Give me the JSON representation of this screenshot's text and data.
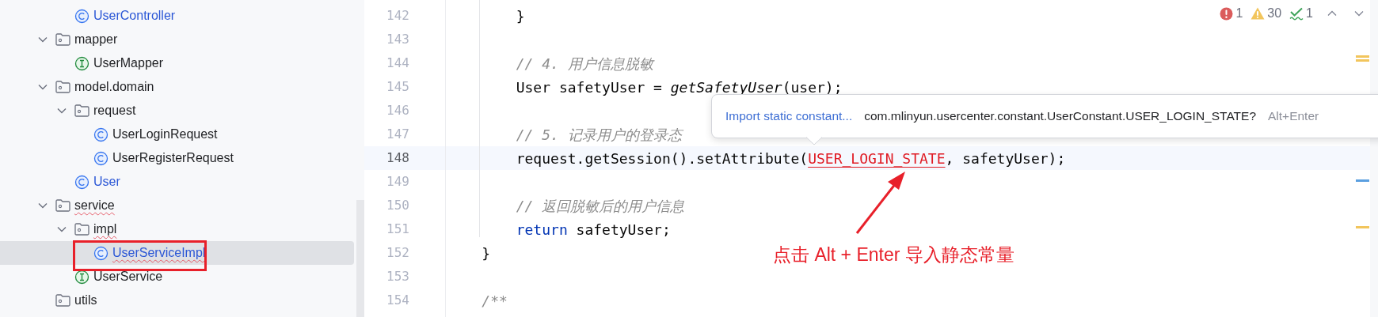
{
  "project_tree": {
    "continued_children": [
      {
        "name": "UserController",
        "kind": "class",
        "modified": true,
        "error": false,
        "selected": false
      }
    ],
    "items": [
      {
        "name": "mapper",
        "kind": "folder",
        "expanded": true,
        "error": false,
        "selected": false,
        "children": [
          {
            "name": "UserMapper",
            "kind": "interface",
            "modified": false,
            "error": false,
            "selected": false
          }
        ]
      },
      {
        "name": "model.domain",
        "kind": "folder",
        "expanded": true,
        "error": false,
        "selected": false,
        "children": [
          {
            "name": "request",
            "kind": "folder",
            "expanded": true,
            "error": false,
            "selected": false,
            "children": [
              {
                "name": "UserLoginRequest",
                "kind": "class",
                "modified": false,
                "error": false,
                "selected": false
              },
              {
                "name": "UserRegisterRequest",
                "kind": "class",
                "modified": false,
                "error": false,
                "selected": false
              }
            ]
          },
          {
            "name": "User",
            "kind": "class",
            "modified": true,
            "error": false,
            "selected": false
          }
        ]
      },
      {
        "name": "service",
        "kind": "folder",
        "expanded": true,
        "error": true,
        "selected": false,
        "children": [
          {
            "name": "impl",
            "kind": "folder",
            "expanded": true,
            "error": true,
            "selected": false,
            "children": [
              {
                "name": "UserServiceImpl",
                "kind": "class",
                "modified": true,
                "error": true,
                "selected": true,
                "framed": true
              }
            ]
          },
          {
            "name": "UserService",
            "kind": "interface",
            "modified": false,
            "error": false,
            "selected": false
          }
        ]
      },
      {
        "name": "utils",
        "kind": "folder",
        "expanded": false,
        "error": false,
        "selected": false
      }
    ]
  },
  "inspections": [
    {
      "kind": "error",
      "count": "1"
    },
    {
      "kind": "warning",
      "count": "30"
    },
    {
      "kind": "typo",
      "count": "1"
    }
  ],
  "stripe_marks": [
    {
      "kind": "warning"
    },
    {
      "kind": "info"
    },
    {
      "kind": "warning"
    }
  ],
  "code_lines": [
    {
      "number": "142",
      "current": false,
      "tokens": [
        {
          "kind": "plain",
          "text": "        }"
        }
      ]
    },
    {
      "number": "143",
      "current": false
    },
    {
      "number": "144",
      "current": false,
      "tokens": [
        {
          "kind": "comment",
          "text": "        // 4. 用户信息脱敏"
        }
      ]
    },
    {
      "number": "145",
      "current": false,
      "tokens": [
        {
          "kind": "plain",
          "text": "        User safetyUser = "
        },
        {
          "kind": "static_call",
          "text": "getSafetyUser"
        },
        {
          "kind": "plain",
          "text": "(user);"
        }
      ]
    },
    {
      "number": "146",
      "current": false
    },
    {
      "number": "147",
      "current": false,
      "tokens": [
        {
          "kind": "comment",
          "text": "        // 5. 记录用户的登录态"
        }
      ]
    },
    {
      "number": "148",
      "current": true,
      "tokens": [
        {
          "kind": "plain",
          "text": "        request.getSession().setAttribute("
        },
        {
          "kind": "unresolved",
          "text": "USER_LOGIN_STATE"
        },
        {
          "kind": "plain",
          "text": ", safetyUser);"
        }
      ]
    },
    {
      "number": "149",
      "current": false
    },
    {
      "number": "150",
      "current": false,
      "tokens": [
        {
          "kind": "comment",
          "text": "        // 返回脱敏后的用户信息"
        }
      ]
    },
    {
      "number": "151",
      "current": false,
      "tokens": [
        {
          "kind": "keyword",
          "text": "        return"
        },
        {
          "kind": "plain",
          "text": " safetyUser;"
        }
      ]
    },
    {
      "number": "152",
      "current": false,
      "tokens": [
        {
          "kind": "plain",
          "text": "    }"
        }
      ]
    },
    {
      "number": "153",
      "current": false
    },
    {
      "number": "154",
      "current": false,
      "tokens": [
        {
          "kind": "comment_doc",
          "text": "    /**"
        }
      ]
    }
  ],
  "import_popup": {
    "action": "Import static constant...",
    "target": "com.mlinyun.usercenter.constant.UserConstant.USER_LOGIN_STATE?",
    "shortcut": "Alt+Enter"
  },
  "annotation": {
    "text": "点击 Alt + Enter 导入静态常量"
  }
}
